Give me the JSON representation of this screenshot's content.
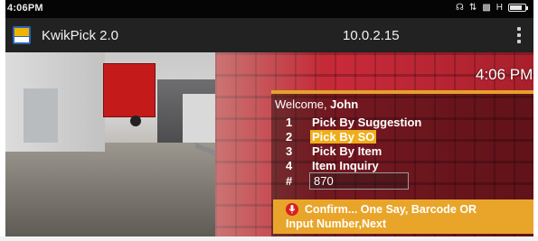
{
  "status_bar": {
    "time": "4:06PM",
    "icons": [
      "headphones-icon",
      "data-transfer-icon",
      "signal-icon",
      "network-type-icon",
      "battery-icon"
    ],
    "network_type": "H",
    "battery_level_percent": 80
  },
  "app_bar": {
    "title": "KwikPick 2.0",
    "ip_address": "10.0.2.15",
    "menu_icon": "overflow-menu-icon"
  },
  "screen": {
    "clock": "4:06 PM",
    "welcome_prefix": "Welcome, ",
    "user_name": "John",
    "menu": [
      {
        "number": "1",
        "label": "Pick By Suggestion",
        "selected": false
      },
      {
        "number": "2",
        "label": "Pick By SO",
        "selected": true
      },
      {
        "number": "3",
        "label": "Pick By Item",
        "selected": false
      },
      {
        "number": "4",
        "label": "Item Inquiry",
        "selected": false
      }
    ],
    "entry": {
      "label": "#",
      "value": "870"
    },
    "prompt": {
      "icon": "microphone-icon",
      "line1": "Confirm... One Say, Barcode OR",
      "line2": "Input Number,Next"
    }
  },
  "colors": {
    "accent_gold": "#e8a52a",
    "selected_highlight": "#f0ad1a",
    "appbar_bg": "#222222",
    "statusbar_bg": "#050505",
    "mic_red": "#d82020"
  }
}
